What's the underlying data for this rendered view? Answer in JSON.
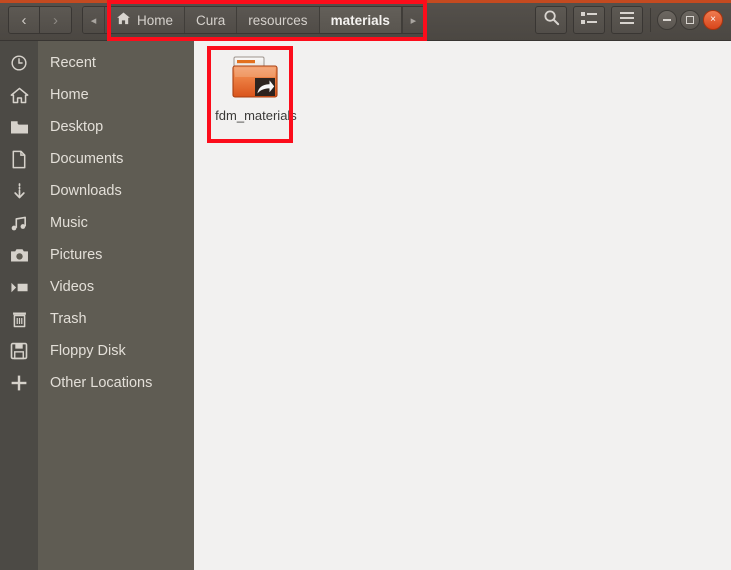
{
  "window": {
    "accent_color": "#c44a20",
    "header_bg": "#504c48",
    "sidebar_bg": "#5f5c53",
    "content_bg": "#f2f1f0",
    "annotation_color": "#fc0d1b"
  },
  "header": {
    "nav": {
      "back_label": "‹",
      "back_name": "back-button",
      "forward_label": "›",
      "forward_name": "forward-button"
    },
    "breadcrumb": {
      "scroll_left": "◂",
      "scroll_right": "▸",
      "items": [
        {
          "label": "Home",
          "icon": "home-icon",
          "active": false
        },
        {
          "label": "Cura",
          "icon": "",
          "active": false
        },
        {
          "label": "resources",
          "icon": "",
          "active": false
        },
        {
          "label": "materials",
          "icon": "",
          "active": true
        }
      ]
    },
    "actions": [
      {
        "name": "search-button",
        "icon": "search-icon"
      },
      {
        "name": "view-options-button",
        "icon": "list-view-icon"
      },
      {
        "name": "menu-button",
        "icon": "hamburger-menu-icon"
      }
    ],
    "window_controls": [
      {
        "name": "minimize-button",
        "icon": "minimize-icon"
      },
      {
        "name": "maximize-button",
        "icon": "maximize-icon"
      },
      {
        "name": "close-button",
        "icon": "close-icon",
        "label": "×"
      }
    ]
  },
  "sidebar": {
    "items": [
      {
        "label": "Recent",
        "icon": "clock-icon"
      },
      {
        "label": "Home",
        "icon": "home-icon"
      },
      {
        "label": "Desktop",
        "icon": "folder-icon"
      },
      {
        "label": "Documents",
        "icon": "document-icon"
      },
      {
        "label": "Downloads",
        "icon": "download-icon"
      },
      {
        "label": "Music",
        "icon": "music-note-icon"
      },
      {
        "label": "Pictures",
        "icon": "camera-icon"
      },
      {
        "label": "Videos",
        "icon": "video-icon"
      },
      {
        "label": "Trash",
        "icon": "trash-icon"
      },
      {
        "label": "Floppy Disk",
        "icon": "floppy-disk-icon"
      },
      {
        "label": "Other Locations",
        "icon": "plus-icon"
      }
    ]
  },
  "content": {
    "files": [
      {
        "name": "fdm_materials",
        "icon": "folder-symlink-icon",
        "type": "folder-shortcut"
      }
    ]
  }
}
